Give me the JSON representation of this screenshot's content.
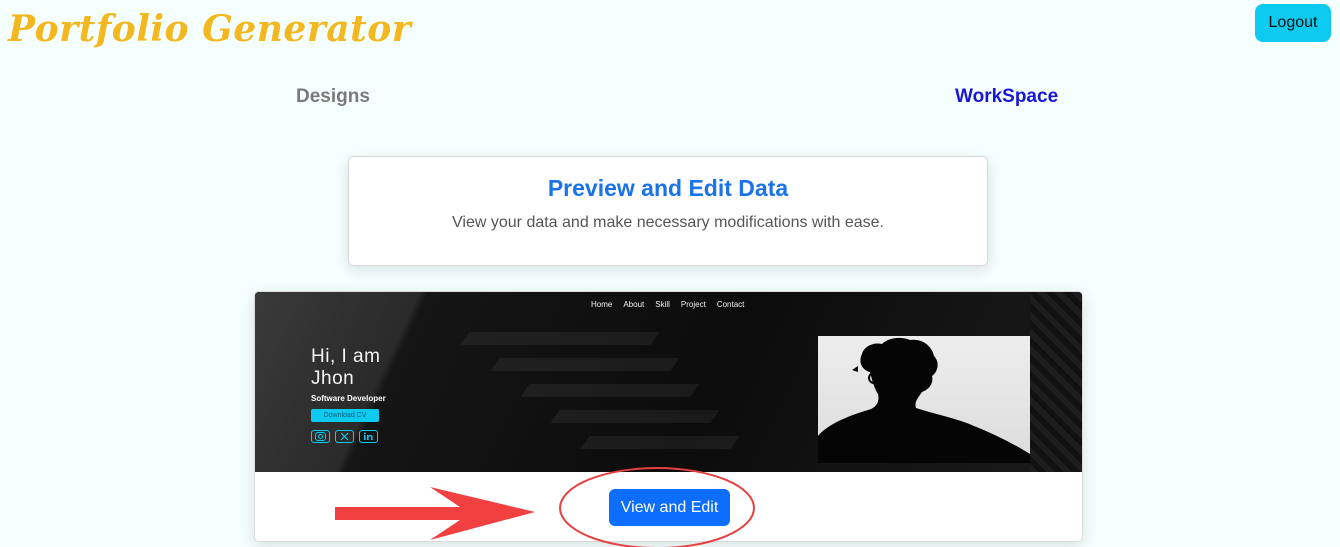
{
  "header": {
    "brand": "Portfolio Generator",
    "logout_label": "Logout"
  },
  "nav": {
    "designs": "Designs",
    "workspace": "WorkSpace"
  },
  "info_card": {
    "title": "Preview and Edit Data",
    "subtitle": "View your data and make necessary modifications with ease."
  },
  "preview": {
    "nav_items": [
      "Home",
      "About",
      "Skill",
      "Project",
      "Contact"
    ],
    "greeting_line1": "Hi, I am",
    "greeting_line2": "Jhon",
    "role": "Software Developer",
    "cv_label": "Download CV",
    "socials": [
      "instagram-icon",
      "x-twitter-icon",
      "linkedin-icon"
    ]
  },
  "actions": {
    "view_edit_label": "View and Edit"
  },
  "colors": {
    "brand": "#f3b81f",
    "primary": "#0d6efd",
    "info": "#0dcaf0",
    "annotation": "#f04040",
    "workspace_link": "#1a16d6"
  }
}
